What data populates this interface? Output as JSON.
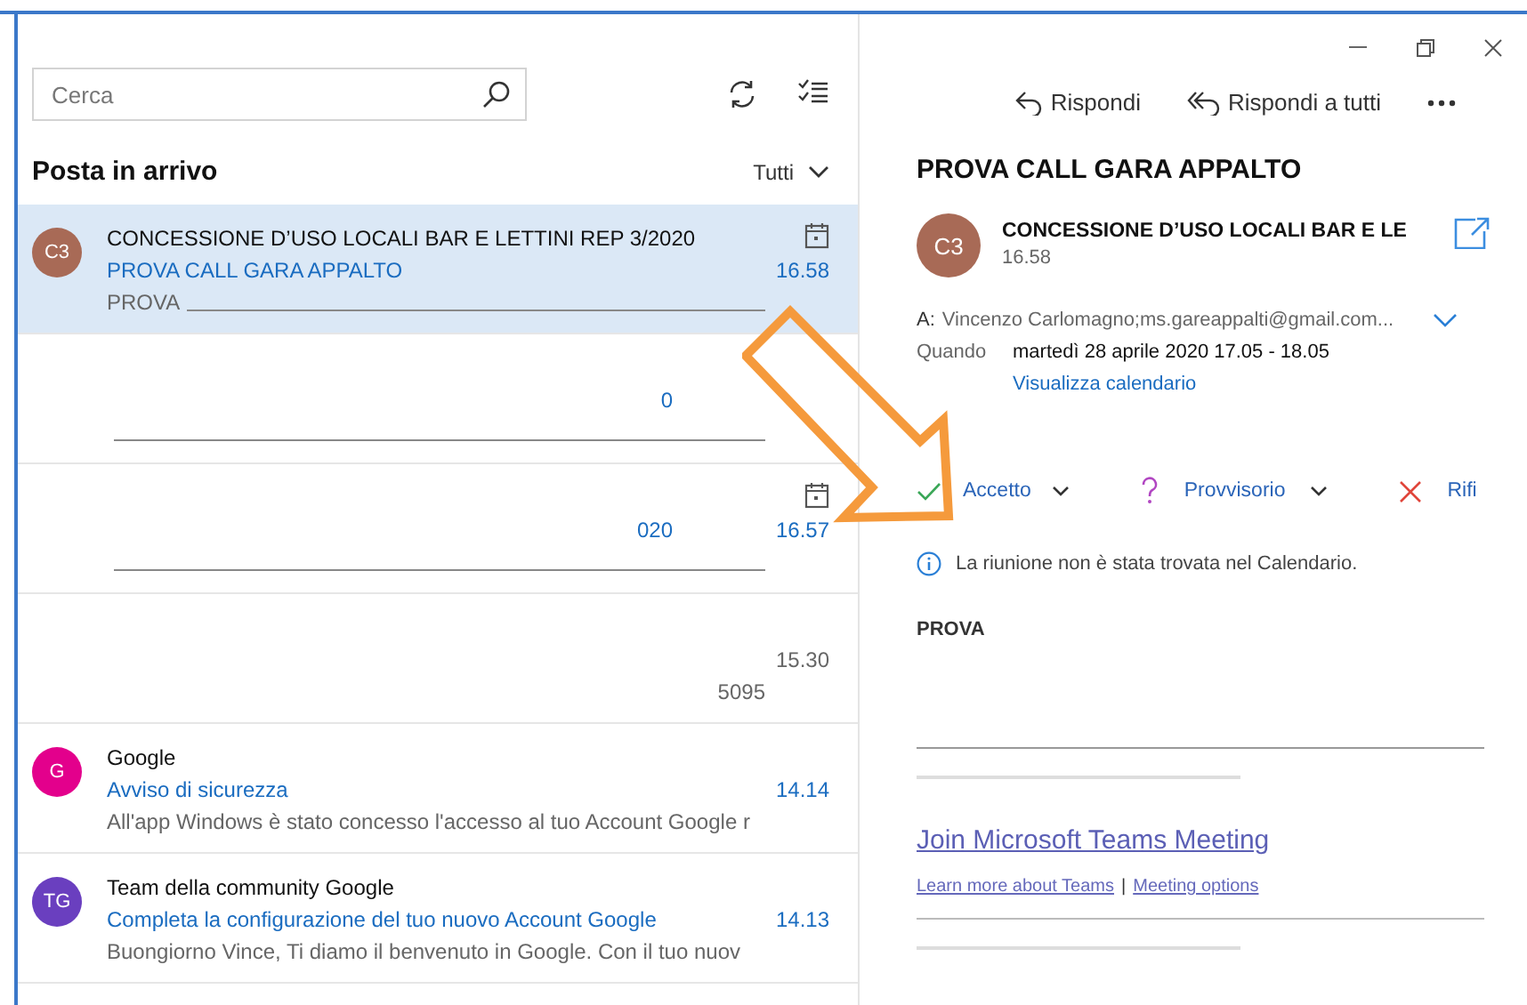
{
  "search": {
    "placeholder": "Cerca"
  },
  "folder": {
    "title": "Posta in arrivo",
    "filter": "Tutti"
  },
  "messages": [
    {
      "kind": "full",
      "selected": true,
      "unread": true,
      "initials": "C3",
      "color": "#a86a56",
      "sender": "CONCESSIONE D’USO LOCALI BAR E LETTINI REP 3/2020",
      "subject": "PROVA CALL GARA APPALTO",
      "preview": "PROVA",
      "preview_rule": true,
      "time": "16.58",
      "calendar": true
    },
    {
      "kind": "redacted",
      "selected": false,
      "unread": true,
      "subject": "0",
      "preview_rule": true,
      "calendar": false
    },
    {
      "kind": "redacted",
      "selected": false,
      "unread": true,
      "subject": "020",
      "preview_rule": true,
      "time": "16.57",
      "calendar": true
    },
    {
      "kind": "redacted",
      "selected": false,
      "unread": false,
      "preview": "5095",
      "preview_rule": false,
      "time": "15.30",
      "calendar": false
    },
    {
      "kind": "full",
      "selected": false,
      "unread": true,
      "initials": "G",
      "color": "#e3008c",
      "sender": "Google",
      "subject": "Avviso di sicurezza",
      "preview": "All'app Windows è stato concesso l'accesso al tuo Account Google r",
      "preview_rule": false,
      "time": "14.14",
      "calendar": false
    },
    {
      "kind": "full",
      "selected": false,
      "unread": true,
      "initials": "TG",
      "color": "#6a3fbf",
      "sender": "Team della community Google",
      "subject": "Completa la configurazione del tuo nuovo Account Google",
      "preview": "Buongiorno Vince, Ti diamo il benvenuto in Google. Con il tuo nuov",
      "preview_rule": false,
      "time": "14.13",
      "calendar": false
    }
  ],
  "reading": {
    "actions": [
      {
        "kind": "reply",
        "label": "Rispondi"
      },
      {
        "kind": "reply_all",
        "label": "Rispondi a tutti"
      },
      {
        "kind": "more"
      }
    ],
    "subject": "PROVA CALL GARA APPALTO",
    "sender": {
      "initials": "C3",
      "color": "#a86a56",
      "name": "CONCESSIONE D’USO LOCALI BAR E LE",
      "time": "16.58"
    },
    "to": {
      "label": "A:",
      "value": "Vincenzo Carlomagno;ms.gareappalti@gmail.com..."
    },
    "when": {
      "label": "Quando",
      "value": "martedì 28 aprile 2020 17.05 - 18.05",
      "link": "Visualizza calendario"
    },
    "responses": [
      {
        "kind": "accept",
        "label": "Accetto",
        "caret": true
      },
      {
        "kind": "tentative",
        "label": "Provvisorio",
        "caret": true
      },
      {
        "kind": "decline",
        "label": "Rifi",
        "caret": false
      }
    ],
    "notice": "La riunione non è stata trovata nel Calendario.",
    "body": {
      "text": "PROVA",
      "join_link": "Join Microsoft Teams Meeting",
      "links": [
        "Learn more about Teams",
        "Meeting options"
      ],
      "separator": "|"
    }
  }
}
